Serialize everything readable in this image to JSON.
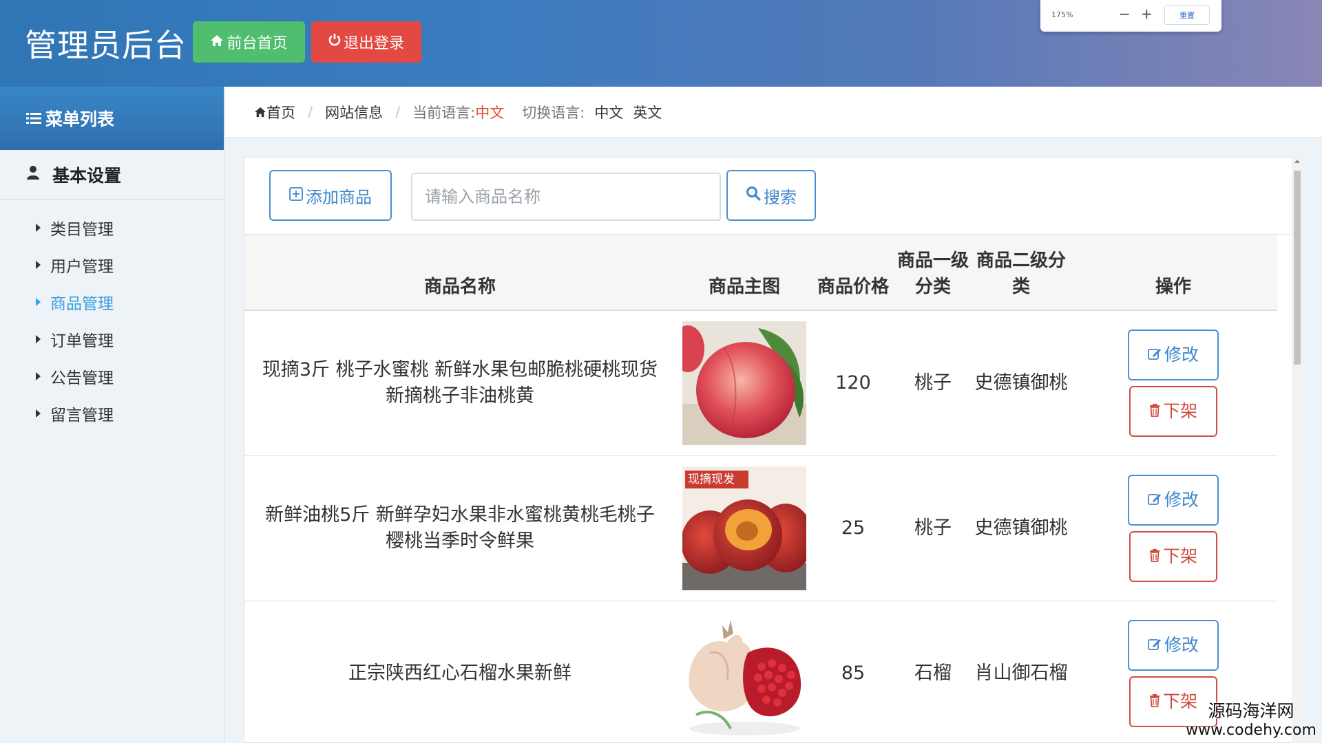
{
  "header": {
    "title": "管理员后台",
    "home_button": "前台首页",
    "logout_button": "退出登录",
    "home_icon": "home-icon",
    "logout_icon": "power-icon"
  },
  "zoom_widget": {
    "value": "175%",
    "minus": "−",
    "plus": "+",
    "reset": "重置"
  },
  "sidebar": {
    "title": "菜单列表",
    "group": "基本设置",
    "items": [
      {
        "label": "类目管理",
        "active": false
      },
      {
        "label": "用户管理",
        "active": false
      },
      {
        "label": "商品管理",
        "active": true
      },
      {
        "label": "订单管理",
        "active": false
      },
      {
        "label": "公告管理",
        "active": false
      },
      {
        "label": "留言管理",
        "active": false
      }
    ]
  },
  "breadcrumb": {
    "home": "首页",
    "site_info": "网站信息",
    "current_lang_label": "当前语言:",
    "current_lang": "中文",
    "switch_label": "切换语言:",
    "lang_zh": "中文",
    "lang_en": "英文"
  },
  "toolbar": {
    "add_button": "添加商品",
    "search_placeholder": "请输入商品名称",
    "search_button": "搜索"
  },
  "table": {
    "headers": {
      "name": "商品名称",
      "image": "商品主图",
      "price": "商品价格",
      "cat1": "商品一级分类",
      "cat2": "商品二级分类",
      "ops": "操作"
    },
    "rows": [
      {
        "name": "现摘3斤 桃子水蜜桃 新鲜水果包邮脆桃硬桃现货新摘桃子非油桃黄",
        "price": "120",
        "cat1": "桃子",
        "cat2": "史德镇御桃",
        "edit": "修改",
        "remove": "下架"
      },
      {
        "name": "新鲜油桃5斤 新鲜孕妇水果非水蜜桃黄桃毛桃子樱桃当季时令鲜果",
        "price": "25",
        "cat1": "桃子",
        "cat2": "史德镇御桃",
        "edit": "修改",
        "remove": "下架",
        "image_tag": "现摘现发"
      },
      {
        "name": "正宗陕西红心石榴水果新鲜",
        "price": "85",
        "cat1": "石榴",
        "cat2": "肖山御石榴",
        "edit": "修改",
        "remove": "下架"
      }
    ]
  },
  "watermark": {
    "line1": "源码海洋网",
    "line2": "www.codehy.com"
  },
  "colors": {
    "header_start": "#2f76b4",
    "header_end": "#8a86b6",
    "home_green": "#4fbe6e",
    "logout_red": "#e24942",
    "accent_blue": "#3d87cc",
    "danger": "#d24a3f"
  }
}
